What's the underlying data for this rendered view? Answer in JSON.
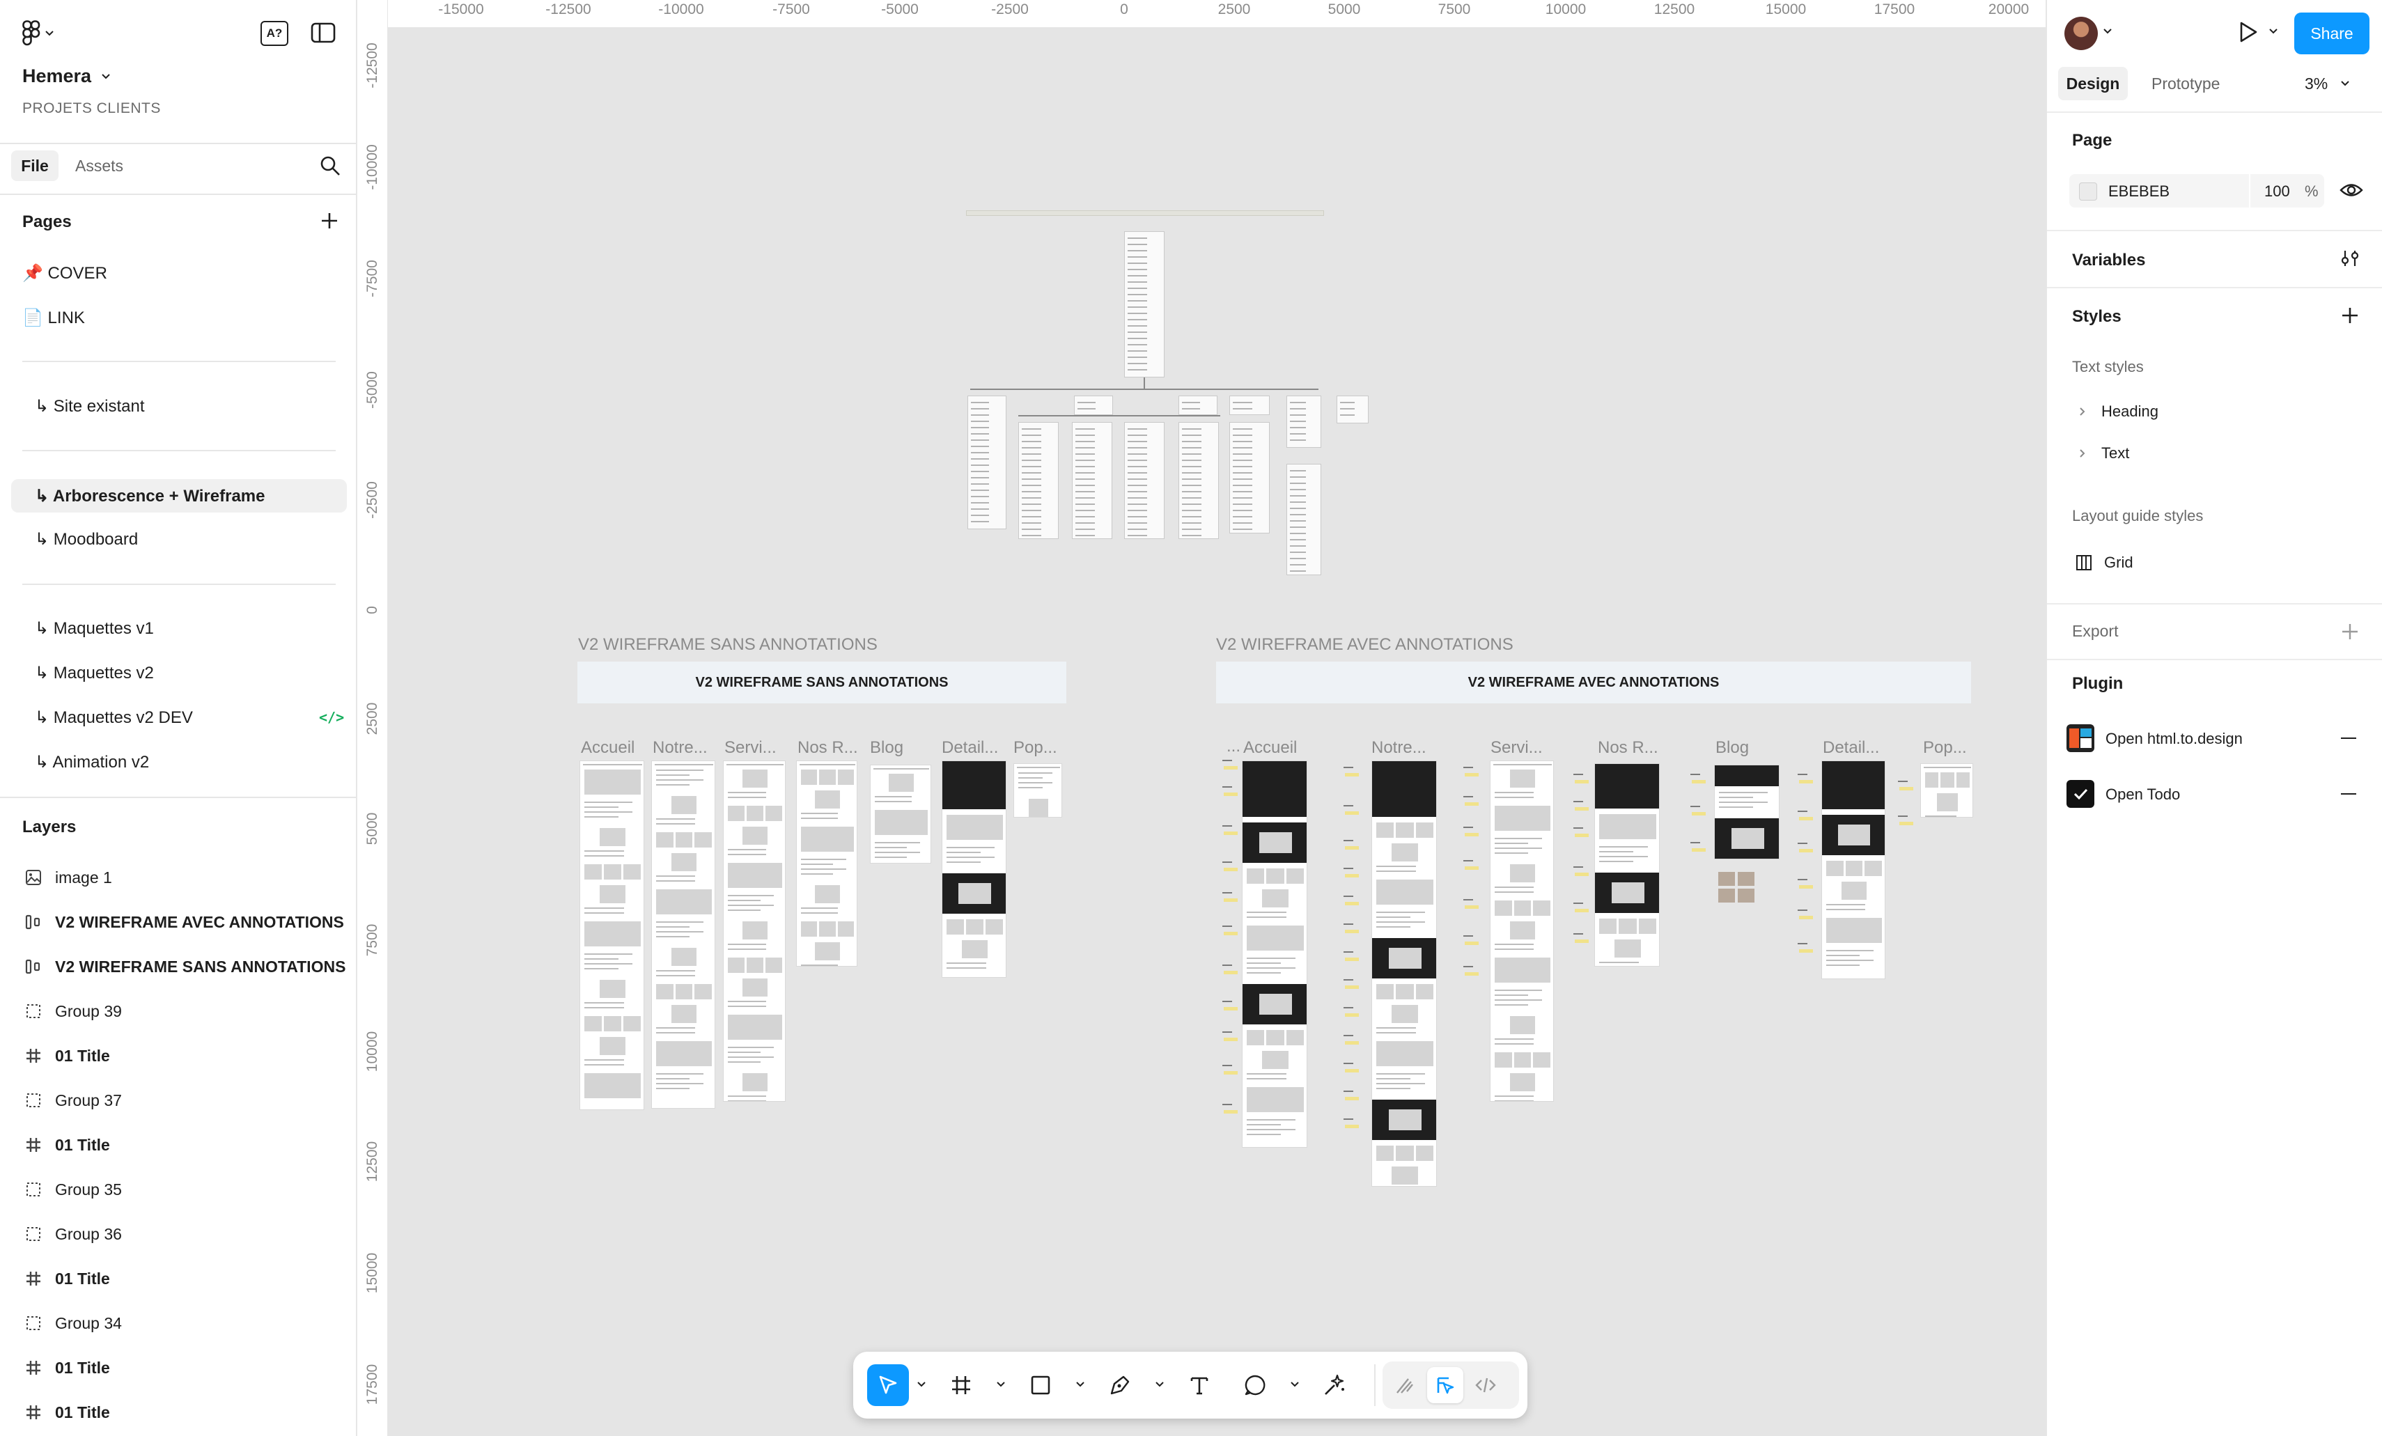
{
  "app": {
    "file_name": "Hemera",
    "project": "PROJETS CLIENTS"
  },
  "left_panel": {
    "tabs": [
      "File",
      "Assets"
    ],
    "pages_title": "Pages",
    "pages": [
      {
        "label": "📌 COVER"
      },
      {
        "label": "📄 LINK"
      },
      {
        "label": "↳ Site existant"
      },
      {
        "label": "↳ Arborescence + Wireframe",
        "selected": true
      },
      {
        "label": "↳ Moodboard"
      },
      {
        "label": "↳ Maquettes v1"
      },
      {
        "label": "↳ Maquettes v2"
      },
      {
        "label": "↳ Maquettes v2 DEV",
        "dev": true
      },
      {
        "label": "↳  Animation v2"
      }
    ],
    "layers_title": "Layers",
    "layers": [
      {
        "label": "image 1",
        "icon": "image-icon",
        "bold": false
      },
      {
        "label": "V2 WIREFRAME AVEC ANNOTATIONS",
        "icon": "autolayout-icon",
        "bold": true
      },
      {
        "label": "V2 WIREFRAME SANS ANNOTATIONS",
        "icon": "autolayout-icon",
        "bold": true
      },
      {
        "label": "Group 39",
        "icon": "group-icon",
        "bold": false
      },
      {
        "label": "01 Title",
        "icon": "frame-icon",
        "bold": true
      },
      {
        "label": "Group 37",
        "icon": "group-icon",
        "bold": false
      },
      {
        "label": "01 Title",
        "icon": "frame-icon",
        "bold": true
      },
      {
        "label": "Group 35",
        "icon": "group-icon",
        "bold": false
      },
      {
        "label": "Group 36",
        "icon": "group-icon",
        "bold": false
      },
      {
        "label": "01 Title",
        "icon": "frame-icon",
        "bold": true
      },
      {
        "label": "Group 34",
        "icon": "group-icon",
        "bold": false
      },
      {
        "label": "01 Title",
        "icon": "frame-icon",
        "bold": true
      },
      {
        "label": "01 Title",
        "icon": "frame-icon",
        "bold": true
      }
    ]
  },
  "rulers": {
    "horizontal": [
      "-15000",
      "-12500",
      "-10000",
      "-7500",
      "-5000",
      "-2500",
      "0",
      "2500",
      "5000",
      "7500",
      "10000",
      "12500",
      "15000",
      "17500",
      "20000"
    ],
    "vertical": [
      "-12500",
      "-10000",
      "-7500",
      "-5000",
      "-2500",
      "0",
      "2500",
      "5000",
      "7500",
      "10000",
      "12500",
      "15000",
      "17500"
    ]
  },
  "canvas": {
    "sans": {
      "section_label": "V2 WIREFRAME SANS ANNOTATIONS",
      "banner": "V2 WIREFRAME SANS ANNOTATIONS",
      "frames": [
        "Accueil",
        "Notre...",
        "Servi...",
        "Nos R...",
        "Blog",
        "Detail...",
        "Pop..."
      ]
    },
    "avec": {
      "section_label": "V2 WIREFRAME AVEC ANNOTATIONS",
      "banner": "V2 WIREFRAME AVEC ANNOTATIONS",
      "frames": [
        "...",
        "Accueil",
        "Notre...",
        "Servi...",
        "Nos R...",
        "Blog",
        "Detail...",
        "Pop..."
      ]
    }
  },
  "right_panel": {
    "share": "Share",
    "tabs": [
      "Design",
      "Prototype"
    ],
    "zoom": "3%",
    "page_title": "Page",
    "page_color": "EBEBEB",
    "page_opacity": "100",
    "percent": "%",
    "variables": "Variables",
    "styles": "Styles",
    "text_styles_title": "Text styles",
    "text_styles": [
      "Heading",
      "Text"
    ],
    "layout_guide_title": "Layout guide styles",
    "layout_guide_item": "Grid",
    "export": "Export",
    "plugin_title": "Plugin",
    "plugins": [
      "Open html.to.design",
      "Open Todo"
    ]
  },
  "help": "?",
  "colors": {
    "accent": "#0d99ff",
    "canvas": "#e5e5e5",
    "dev_green": "#14ae5c",
    "selected_row": "#f0f0f0"
  }
}
